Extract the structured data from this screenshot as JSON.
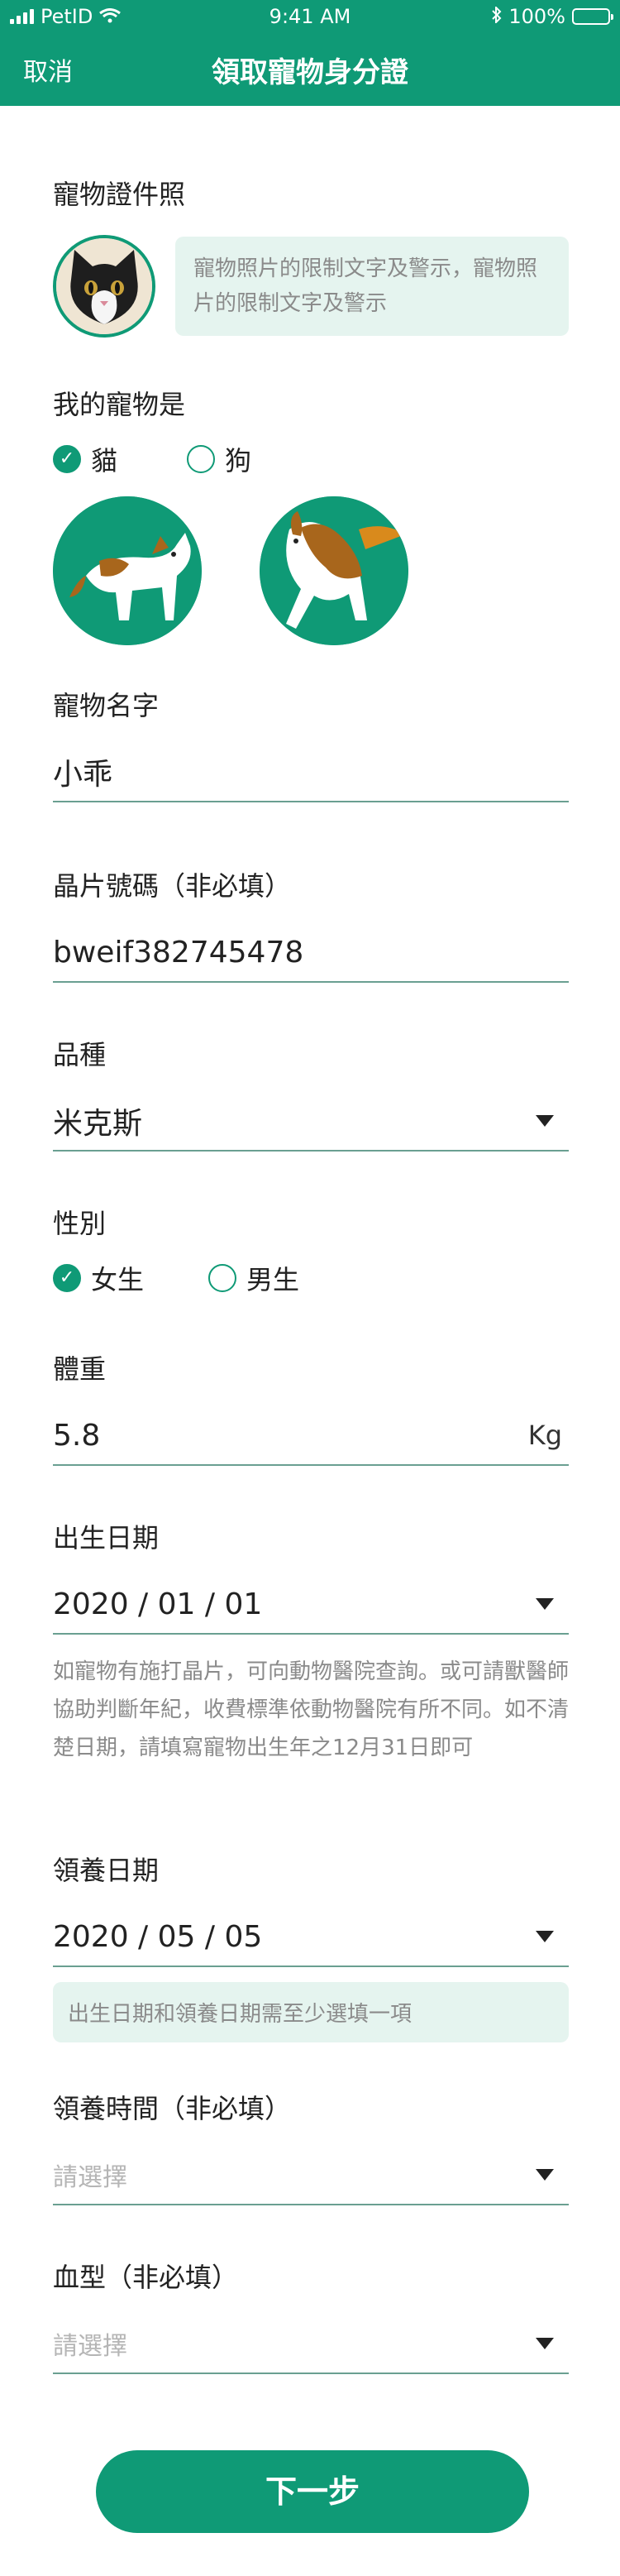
{
  "status_bar": {
    "carrier": "PetID",
    "time": "9:41 AM",
    "battery": "100%"
  },
  "nav": {
    "cancel": "取消",
    "title": "領取寵物身分證"
  },
  "photo": {
    "label": "寵物證件照",
    "notice": "寵物照片的限制文字及警示，寵物照片的限制文字及警示"
  },
  "pet_type": {
    "label": "我的寵物是",
    "options": [
      {
        "label": "貓",
        "selected": true
      },
      {
        "label": "狗",
        "selected": false
      }
    ]
  },
  "name": {
    "label": "寵物名字",
    "value": "小乖"
  },
  "chip": {
    "label": "晶片號碼（非必填）",
    "value": "bweif382745478"
  },
  "breed": {
    "label": "品種",
    "value": "米克斯"
  },
  "gender": {
    "label": "性別",
    "options": [
      {
        "label": "女生",
        "selected": true
      },
      {
        "label": "男生",
        "selected": false
      }
    ]
  },
  "weight": {
    "label": "體重",
    "value": "5.8",
    "unit": "Kg"
  },
  "birth": {
    "label": "出生日期",
    "value": "2020 / 01 / 01",
    "hint": "如寵物有施打晶片，可向動物醫院查詢。或可請獸醫師協助判斷年紀，收費標準依動物醫院有所不同。如不清楚日期，請填寫寵物出生年之12月31日即可"
  },
  "adopt_date": {
    "label": "領養日期",
    "value": "2020 / 05 / 05",
    "hint": "出生日期和領養日期需至少選填一項"
  },
  "adopt_time": {
    "label": "領養時間（非必填）",
    "placeholder": "請選擇"
  },
  "blood": {
    "label": "血型（非必填）",
    "placeholder": "請選擇"
  },
  "next_button": "下一步",
  "colors": {
    "primary": "#0f9a76",
    "notice_bg": "#e5f4ef"
  }
}
